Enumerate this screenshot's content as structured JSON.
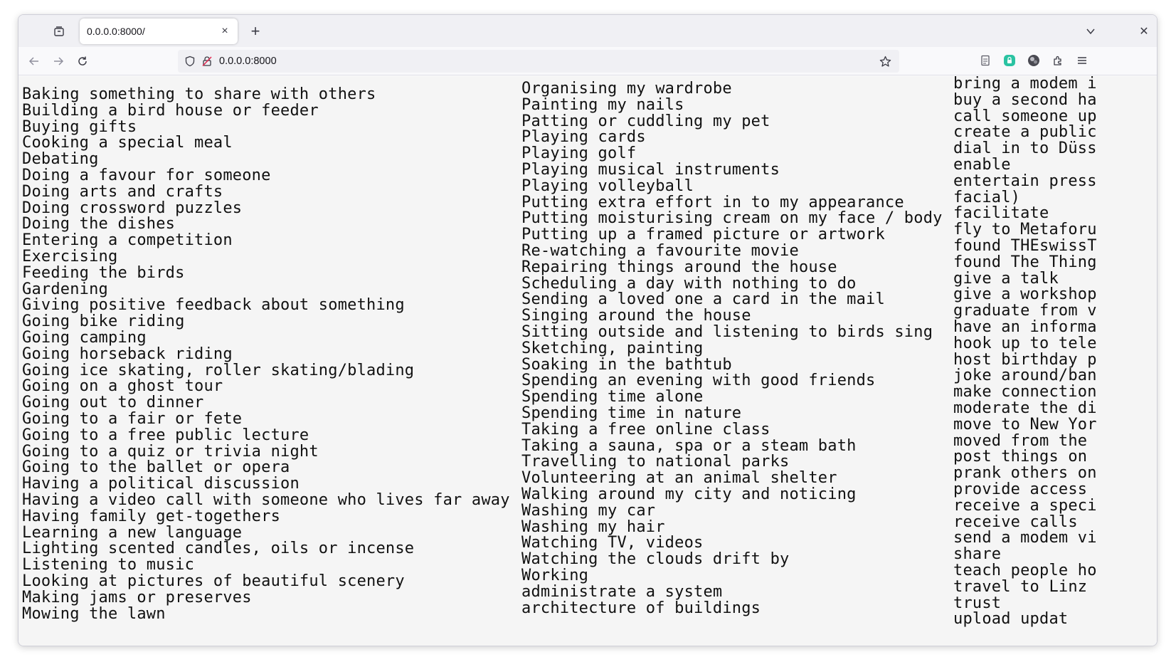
{
  "browser": {
    "tab_title": "0.0.0.0:8000/",
    "tab_close": "×",
    "new_tab": "+",
    "url": "0.0.0.0:8000",
    "window_close": "✕",
    "icons": {
      "tab_list": "tab-list-icon",
      "back": "arrow-left-icon",
      "forward": "arrow-right-icon",
      "reload": "reload-icon",
      "shield": "shield-icon",
      "lock": "lock-icon",
      "bookmark": "star-icon",
      "reader": "reader-view-icon",
      "extension_green": "extension-icon",
      "account": "account-icon",
      "extensions": "puzzle-icon",
      "menu": "hamburger-menu-icon",
      "tabs_dropdown": "chevron-down-icon"
    },
    "accent_color": "#2ac3a2"
  },
  "columns": [
    {
      "items": [
        "Baking something to share with others",
        "Building a bird house or feeder",
        "Buying gifts",
        "Cooking a special meal",
        "Debating",
        "Doing a favour for someone",
        "Doing arts and crafts",
        "Doing crossword puzzles",
        "Doing the dishes",
        "Entering a competition",
        "Exercising",
        "Feeding the birds",
        "Gardening",
        "Giving positive feedback about something",
        "Going bike riding",
        "Going camping",
        "Going horseback riding",
        "Going ice skating, roller skating/blading",
        "Going on a ghost tour",
        "Going out to dinner",
        "Going to a fair or fete",
        "Going to a free public lecture",
        "Going to a quiz or trivia night",
        "Going to the ballet or opera",
        "Having a political discussion",
        "Having a video call with someone who lives far away",
        "Having family get-togethers",
        "Learning a new language",
        "Lighting scented candles, oils or incense",
        "Listening to music",
        "Looking at pictures of beautiful scenery",
        "Making jams or preserves",
        "Mowing the lawn"
      ]
    },
    {
      "items": [
        "Organising my wardrobe",
        "Painting my nails",
        "Patting or cuddling my pet",
        "Playing cards",
        "Playing golf",
        "Playing musical instruments",
        "Playing volleyball",
        "Putting extra effort in to my appearance",
        "Putting moisturising cream on my face / body",
        "Putting up a framed picture or artwork",
        "Re-watching a favourite movie",
        "Repairing things around the house",
        "Scheduling a day with nothing to do",
        "Sending a loved one a card in the mail",
        "Singing around the house",
        "Sitting outside and listening to birds sing",
        "Sketching, painting",
        "Soaking in the bathtub",
        "Spending an evening with good friends",
        "Spending time alone",
        "Spending time in nature",
        "Taking a free online class",
        "Taking a sauna, spa or a steam bath",
        "Travelling to national parks",
        "Volunteering at an animal shelter",
        "Walking around my city and noticing",
        "Washing my car",
        "Washing my hair",
        "Watching TV, videos",
        "Watching the clouds drift by",
        "Working",
        "administrate a system",
        "architecture of buildings"
      ]
    },
    {
      "items": [
        "bring a modem i",
        "buy a second ha",
        "call someone up",
        "create a public",
        "dial in to Düss",
        "enable",
        "entertain press",
        "facial)",
        "facilitate",
        "fly to Metaforu",
        "found THEswissT",
        "found The Thing",
        "give a talk",
        "give a workshop",
        "graduate from v",
        "have an informa",
        "hook up to tele",
        "host birthday p",
        "joke around/ban",
        "make connection",
        "moderate the di",
        "move to New Yor",
        "moved from the",
        "post things on",
        "prank others on",
        "provide access",
        "receive a speci",
        "receive calls",
        "send a modem vi",
        "share",
        "teach people ho",
        "travel to Linz",
        "trust",
        "upload updat"
      ]
    }
  ]
}
